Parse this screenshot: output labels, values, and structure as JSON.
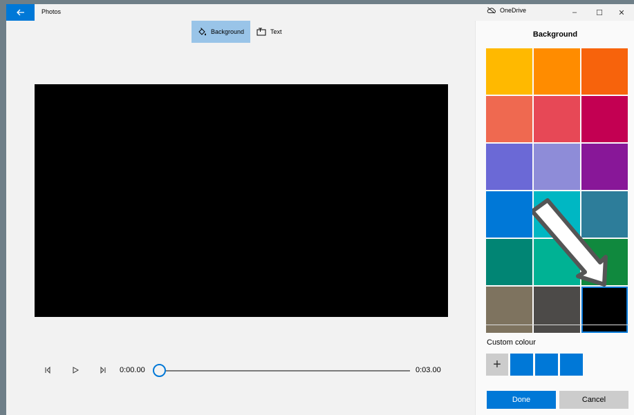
{
  "titlebar": {
    "back_icon": "back-arrow-icon",
    "app_title": "Photos",
    "onedrive_label": "OneDrive",
    "minimize_glyph": "–",
    "maximize_glyph": "☐",
    "close_glyph": "✕"
  },
  "toolbar": {
    "background_label": "Background",
    "text_label": "Text"
  },
  "playback": {
    "current_time": "0:00.00",
    "total_time": "0:03.00",
    "progress": 0
  },
  "panel": {
    "title": "Background",
    "selected_swatch_index": 17,
    "swatches": [
      "#ffb900",
      "#ff8c00",
      "#f7630c",
      "#ef6950",
      "#e74856",
      "#c30052",
      "#6b69d6",
      "#8e8cd8",
      "#881798",
      "#0078d7",
      "#00b7c3",
      "#2d7d9a",
      "#018574",
      "#00b294",
      "#10893e",
      "#7e735f",
      "#4c4a48",
      "#000000"
    ],
    "custom_colour_label": "Custom colour",
    "custom_add_glyph": "+",
    "custom_swatches": [
      "#0078d7",
      "#0078d7",
      "#0078d7"
    ],
    "done_label": "Done",
    "cancel_label": "Cancel"
  },
  "colors": {
    "accent": "#0078d7",
    "preview_background": "#000000",
    "toolbar_active": "#99c4e8"
  }
}
